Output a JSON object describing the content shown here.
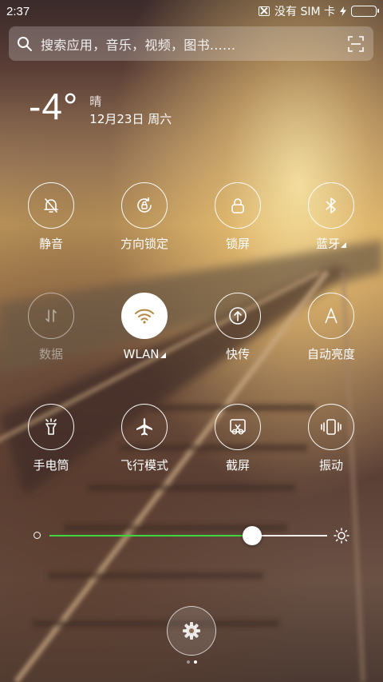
{
  "status_bar": {
    "time": "2:37",
    "sim_status": "没有 SIM 卡",
    "battery_color": "#42d442"
  },
  "search": {
    "placeholder": "搜索应用，音乐，视频，图书......",
    "icon": "search-icon",
    "scan_icon": "scan-icon"
  },
  "weather": {
    "temperature": "-4°",
    "condition": "晴",
    "date": "12月23日 周六"
  },
  "toggles": [
    {
      "label": "静音",
      "icon": "bell-off-icon",
      "state": "off"
    },
    {
      "label": "方向锁定",
      "icon": "rotation-lock-icon",
      "state": "off"
    },
    {
      "label": "锁屏",
      "icon": "lock-icon",
      "state": "off"
    },
    {
      "label": "蓝牙",
      "icon": "bluetooth-icon",
      "state": "off",
      "has_menu": true
    },
    {
      "label": "数据",
      "icon": "mobile-data-icon",
      "state": "disabled"
    },
    {
      "label": "WLAN",
      "icon": "wifi-icon",
      "state": "on",
      "has_menu": true
    },
    {
      "label": "快传",
      "icon": "quick-transfer-icon",
      "state": "off"
    },
    {
      "label": "自动亮度",
      "icon": "auto-brightness-icon",
      "state": "off"
    },
    {
      "label": "手电筒",
      "icon": "flashlight-icon",
      "state": "off"
    },
    {
      "label": "飞行模式",
      "icon": "airplane-icon",
      "state": "off"
    },
    {
      "label": "截屏",
      "icon": "screenshot-icon",
      "state": "off"
    },
    {
      "label": "振动",
      "icon": "vibrate-icon",
      "state": "off"
    }
  ],
  "brightness": {
    "level_percent": 73,
    "fill_color": "#3fd63f"
  },
  "settings_button": {
    "icon": "gear-icon"
  },
  "page_indicator": {
    "count": 2,
    "current": 2
  },
  "accent_color": "#42d442"
}
